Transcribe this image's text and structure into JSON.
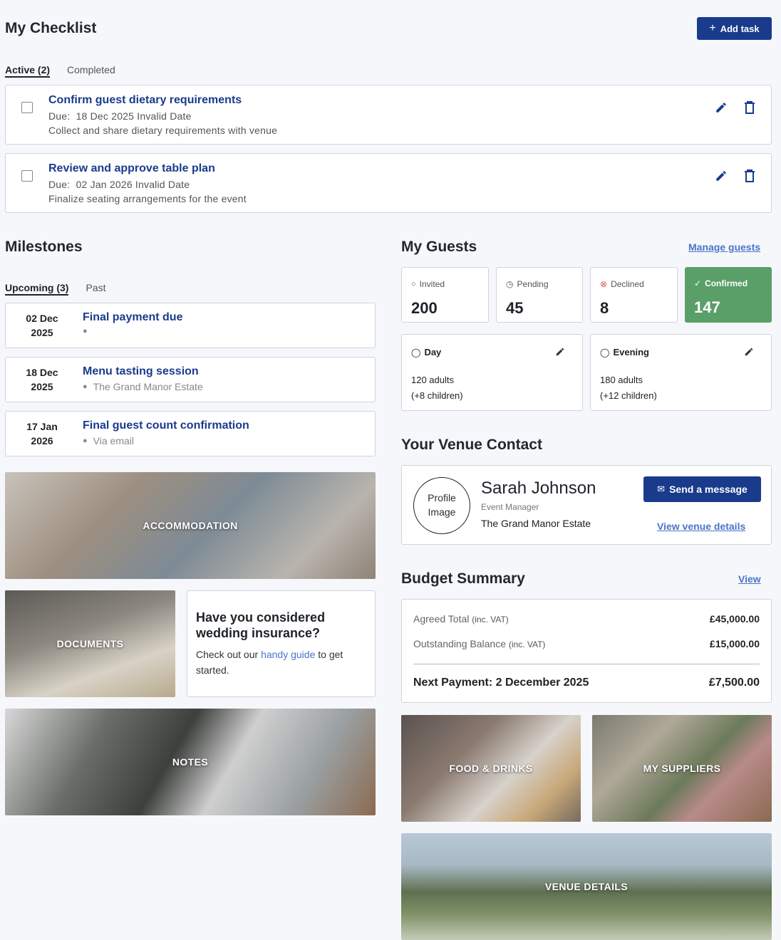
{
  "checklist": {
    "title": "My Checklist",
    "add_label": "Add task",
    "tabs": [
      "Active (2)",
      "Completed"
    ],
    "tasks": [
      {
        "title": "Confirm guest dietary requirements",
        "due_label": "Due:",
        "due": "18 Dec 2025 Invalid Date",
        "desc": "Collect and share dietary requirements with venue"
      },
      {
        "title": "Review and approve table plan",
        "due_label": "Due:",
        "due": "02 Jan 2026 Invalid Date",
        "desc": "Finalize seating arrangements for the event"
      }
    ]
  },
  "milestones": {
    "title": "Milestones",
    "tabs": [
      "Upcoming (3)",
      "Past"
    ],
    "items": [
      {
        "day": "02 Dec",
        "year": "2025",
        "title": "Final payment due",
        "location": ""
      },
      {
        "day": "18 Dec",
        "year": "2025",
        "title": "Menu tasting session",
        "location": "The Grand Manor Estate"
      },
      {
        "day": "17 Jan",
        "year": "2026",
        "title": "Final guest count confirmation",
        "location": "Via email"
      }
    ]
  },
  "tiles": {
    "accommodation": "ACCOMMODATION",
    "documents": "DOCUMENTS",
    "notes": "NOTES",
    "food": "FOOD & DRINKS",
    "suppliers": "MY SUPPLIERS",
    "venue": "VENUE DETAILS"
  },
  "insurance": {
    "title": "Have you considered wedding insurance?",
    "text_before": "Check out our ",
    "link": "handy guide",
    "text_after": " to get started."
  },
  "guests": {
    "title": "My Guests",
    "manage_label": "Manage guests",
    "stats": [
      {
        "label": "Invited",
        "value": "200"
      },
      {
        "label": "Pending",
        "value": "45"
      },
      {
        "label": "Declined",
        "value": "8"
      },
      {
        "label": "Confirmed",
        "value": "147"
      }
    ],
    "day": {
      "label": "Day",
      "adults": "120 adults",
      "children": "(+8 children)"
    },
    "evening": {
      "label": "Evening",
      "adults": "180 adults",
      "children": "(+12 children)"
    }
  },
  "contact": {
    "title": "Your Venue Contact",
    "image_alt": "Profile Image",
    "name": "Sarah Johnson",
    "role": "Event Manager",
    "venue": "The Grand Manor Estate",
    "message_label": "Send a message",
    "details_label": "View venue details"
  },
  "budget": {
    "title": "Budget Summary",
    "view_label": "View",
    "agreed_label": "Agreed Total",
    "agreed_note": "(inc. VAT)",
    "agreed_value": "£45,000.00",
    "outstanding_label": "Outstanding Balance",
    "outstanding_note": "(inc. VAT)",
    "outstanding_value": "£15,000.00",
    "next_label": "Next Payment: 2 December 2025",
    "next_value": "£7,500.00"
  },
  "colors": {
    "primary": "#1a3b8c",
    "confirmed": "#5a9e68",
    "declined": "#d9534f",
    "link": "#4a74c9"
  }
}
